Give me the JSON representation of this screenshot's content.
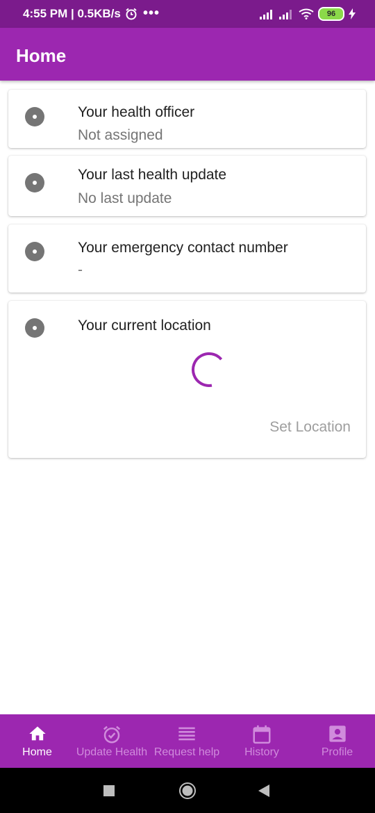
{
  "status_bar": {
    "time_net": "4:55 PM | 0.5KB/s",
    "dots": "•••",
    "battery": "96"
  },
  "app_bar": {
    "title": "Home"
  },
  "cards": [
    {
      "title": "Your health officer",
      "subtitle": "Not assigned"
    },
    {
      "title": "Your last health update",
      "subtitle": "No last update"
    },
    {
      "title": "Your emergency contact number",
      "subtitle": "-"
    },
    {
      "title": "Your current location",
      "action_label": "Set Location"
    }
  ],
  "bottom_nav": {
    "items": [
      {
        "label": "Home",
        "icon": "home-icon",
        "active": true
      },
      {
        "label": "Update Health",
        "icon": "alarm-check-icon",
        "active": false
      },
      {
        "label": "Request help",
        "icon": "list-icon",
        "active": false
      },
      {
        "label": "History",
        "icon": "calendar-icon",
        "active": false
      },
      {
        "label": "Profile",
        "icon": "account-box-icon",
        "active": false
      }
    ]
  },
  "colors": {
    "primary": "#9c27b0",
    "status_bar": "#7b1b8c",
    "inactive_nav": "#d08bdc",
    "spinner": "#9c27b0"
  }
}
